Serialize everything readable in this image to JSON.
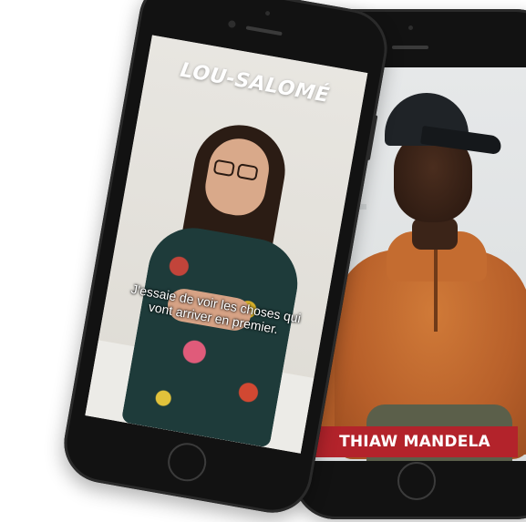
{
  "left_video": {
    "name_title": "LOU-SALOMÉ",
    "subtitle": "J'essaie de voir les choses qui vont arriver en premier."
  },
  "right_video": {
    "name_banner": "THIAW MANDELA"
  },
  "colors": {
    "banner_red": "#b3232b",
    "phone_black": "#121212"
  }
}
